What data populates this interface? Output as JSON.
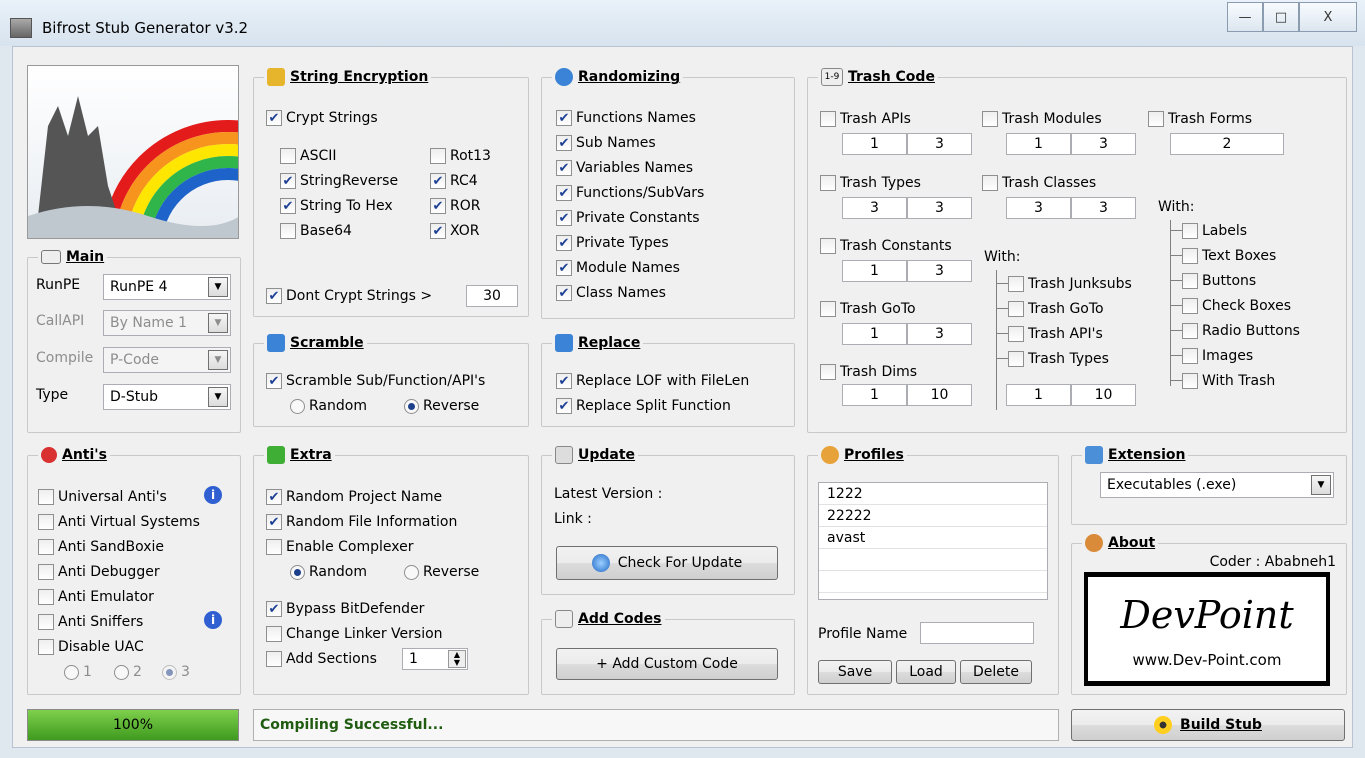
{
  "window": {
    "title": "Bifrost Stub Generator v3.2",
    "minimize": "—",
    "maximize": "□",
    "close": "X"
  },
  "main": {
    "title": "Main",
    "runpe_label": "RunPE",
    "runpe_value": "RunPE 4",
    "callapi_label": "CallAPI",
    "callapi_value": "By Name 1",
    "compile_label": "Compile",
    "compile_value": "P-Code",
    "type_label": "Type",
    "type_value": "D-Stub"
  },
  "string_encryption": {
    "title": "String Encryption",
    "crypt_strings": "Crypt Strings",
    "ascii": "ASCII",
    "stringreverse": "StringReverse",
    "string_to_hex": "String To Hex",
    "base64": "Base64",
    "rot13": "Rot13",
    "rc4": "RC4",
    "ror": "ROR",
    "xor": "XOR",
    "dont_crypt": "Dont Crypt Strings >",
    "dont_crypt_value": "30"
  },
  "randomizing": {
    "title": "Randomizing",
    "items": [
      "Functions Names",
      "Sub Names",
      "Variables Names",
      "Functions/SubVars",
      "Private Constants",
      "Private Types",
      "Module Names",
      "Class Names"
    ]
  },
  "trash_code": {
    "title": "Trash Code",
    "badge": "1-9",
    "apis": "Trash APIs",
    "apis_v": [
      "1",
      "3"
    ],
    "modules": "Trash Modules",
    "modules_v": [
      "1",
      "3"
    ],
    "forms": "Trash Forms",
    "forms_v": "2",
    "types": "Trash Types",
    "types_v": [
      "3",
      "3"
    ],
    "classes": "Trash Classes",
    "classes_v": [
      "3",
      "3"
    ],
    "constants": "Trash Constants",
    "constants_v": [
      "1",
      "3"
    ],
    "goto": "Trash GoTo",
    "goto_v": [
      "1",
      "3"
    ],
    "dims": "Trash Dims",
    "dims_v": [
      "1",
      "10"
    ],
    "with1": "With:",
    "sub1": [
      "Trash Junksubs",
      "Trash GoTo",
      "Trash API's",
      "Trash Types"
    ],
    "sub1_v": [
      "1",
      "10"
    ],
    "with2": "With:",
    "sub2": [
      "Labels",
      "Text Boxes",
      "Buttons",
      "Check Boxes",
      "Radio Buttons",
      "Images",
      "With Trash"
    ]
  },
  "scramble": {
    "title": "Scramble",
    "check": "Scramble Sub/Function/API's",
    "random": "Random",
    "reverse": "Reverse"
  },
  "replace": {
    "title": "Replace",
    "lof": "Replace LOF with FileLen",
    "split": "Replace Split Function"
  },
  "antis": {
    "title": "Anti's",
    "items": [
      "Universal Anti's",
      "Anti Virtual Systems",
      "Anti SandBoxie",
      "Anti Debugger",
      "Anti Emulator",
      "Anti Sniffers",
      "Disable UAC"
    ],
    "r1": "1",
    "r2": "2",
    "r3": "3"
  },
  "extra": {
    "title": "Extra",
    "random_project": "Random Project Name",
    "random_file": "Random File Information",
    "complexer": "Enable Complexer",
    "random": "Random",
    "reverse": "Reverse",
    "bypass": "Bypass BitDefender",
    "linker": "Change Linker Version",
    "sections": "Add Sections",
    "sections_v": "1"
  },
  "update": {
    "title": "Update",
    "latest": "Latest Version  :",
    "link": "Link :",
    "check_btn": "Check For Update"
  },
  "add_codes": {
    "title": "Add Codes",
    "btn": "+ Add Custom Code"
  },
  "profiles": {
    "title": "Profiles",
    "list": [
      "1222",
      "22222",
      "avast"
    ],
    "name_label": "Profile Name",
    "save": "Save",
    "load": "Load",
    "delete": "Delete"
  },
  "extension": {
    "title": "Extension",
    "value": "Executables (.exe)"
  },
  "about": {
    "title": "About",
    "coder": "Coder : Ababneh1",
    "logo": "DevPoint",
    "url": "www.Dev-Point.com"
  },
  "status": {
    "progress_text": "100%",
    "progress": 1.0,
    "message": "Compiling Successful...",
    "build": "Build Stub"
  }
}
